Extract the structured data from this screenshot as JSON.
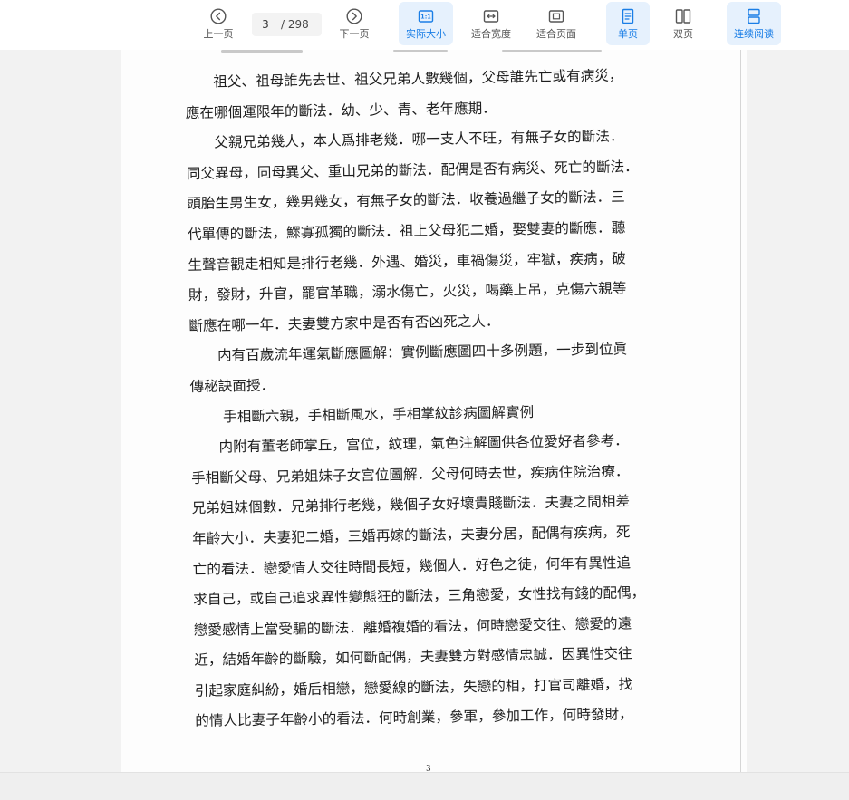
{
  "toolbar": {
    "prev_label": "上一页",
    "next_label": "下一页",
    "current_page": "3",
    "total_pages": "/ 298",
    "actual_size_label": "实际大小",
    "fit_width_label": "适合宽度",
    "fit_page_label": "适合页面",
    "single_page_label": "单页",
    "double_page_label": "双页",
    "continuous_label": "连续阅读",
    "accent_color": "#1a7ee6",
    "active_bg_color": "#e6f1fd"
  },
  "document": {
    "lines": [
      "祖父、祖母誰先去世、祖父兄弟人數幾個，父母誰先亡或有病災，",
      "應在哪個運限年的斷法．幼、少、青、老年應期．",
      "父親兄弟幾人，本人爲排老幾．哪一支人不旺，有無子女的斷法．",
      "同父異母，同母異父、重山兄弟的斷法．配偶是否有病災、死亡的斷法．",
      "頭胎生男生女，幾男幾女，有無子女的斷法．收養過繼子女的斷法．三",
      "代單傳的斷法，鰥寡孤獨的斷法．祖上父母犯二婚，娶雙妻的斷應．聽",
      "生聲音觀走相知是排行老幾．外遇、婚災，車禍傷災，牢獄，疾病，破",
      "財，發財，升官，罷官革職，溺水傷亡，火災，喝藥上吊，克傷六親等",
      "斷應在哪一年．夫妻雙方家中是否有否凶死之人．",
      "内有百歲流年運氣斷應圖解：實例斷應圖四十多例題，一步到位眞",
      "傳秘訣面授．",
      "手相斷六親，手相斷風水，手相掌紋診病圖解實例",
      "内附有董老師掌丘，宫位，紋理，氣色注解圖供各位愛好者參考．",
      "手相斷父母、兄弟姐妹子女宫位圖解．父母何時去世，疾病住院治療．",
      "兄弟姐妹個數．兄弟排行老幾，幾個子女好壞貴賤斷法．夫妻之間相差",
      "年齡大小．夫妻犯二婚，三婚再嫁的斷法，夫妻分居，配偶有疾病，死",
      "亡的看法．戀愛情人交往時間長短，幾個人．好色之徒，何年有異性追",
      "求自己，或自己追求異性變態狂的斷法，三角戀愛，女性找有錢的配偶，",
      "戀愛感情上當受騙的斷法．離婚複婚的看法，何時戀愛交往、戀愛的遠",
      "近，結婚年齡的斷驗，如何斷配偶，夫妻雙方對感情忠誠．因異性交往",
      "引起家庭糾紛，婚后相戀，戀愛線的斷法，失戀的相，打官司離婚，找",
      "的情人比妻子年齡小的看法．何時創業，參軍，參加工作，何時發財，"
    ],
    "page_number": "3"
  }
}
